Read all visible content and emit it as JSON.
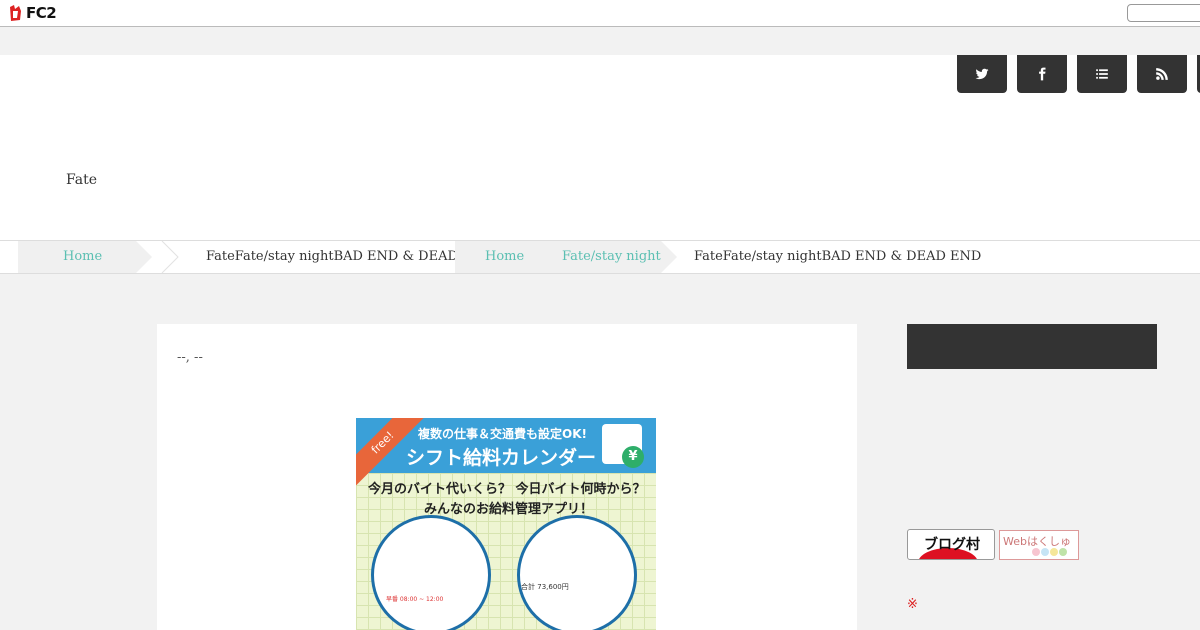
{
  "fc2bar": {
    "logo_text": "FC2",
    "search_value": ""
  },
  "header": {
    "blog_title": "Fate",
    "social": [
      {
        "name": "twitter-icon"
      },
      {
        "name": "facebook-icon"
      },
      {
        "name": "list-icon"
      },
      {
        "name": "rss-icon"
      }
    ]
  },
  "breadcrumb": {
    "home_label_1": "Home",
    "current_label_1": "FateFate/stay nightBAD END & DEAD END",
    "home_label_2": "Home",
    "category_label": "Fate/stay night",
    "current_label_2": "FateFate/stay nightBAD END & DEAD END"
  },
  "article": {
    "date": "--, --",
    "banner": {
      "line1": "複数の仕事＆交通費も設定OK!",
      "line2": "シフト給料カレンダー",
      "ribbon": "free!",
      "line3": "今月のバイト代いくら？ 今日バイト何時から？",
      "line4": "みんなのお給料管理アプリ！",
      "total_label": "合計",
      "total_value": "73,600円",
      "shift_label": "早番 08:00 ~ 12:00"
    }
  },
  "sidebar": {
    "badge1_text": "ブログ村",
    "badge2_text": "Webはくしゅ",
    "note": "※"
  },
  "colors": {
    "accent": "#5bbfb2",
    "dark": "#333333"
  }
}
